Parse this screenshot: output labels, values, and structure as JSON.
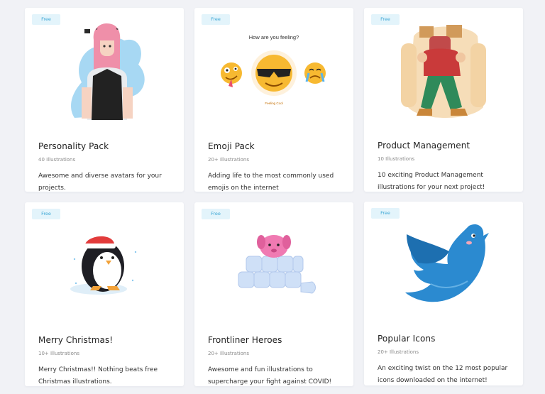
{
  "cards": [
    {
      "badge": "Free",
      "title": "Personality Pack",
      "count": "40 Illustrations",
      "description": "Awesome and diverse avatars for your projects."
    },
    {
      "badge": "Free",
      "title": "Emoji Pack",
      "count": "20+ Illustrations",
      "description": "Adding life to the most commonly used emojis on the internet",
      "art_heading": "How are you feeling?",
      "art_caption": "Feeling Cool"
    },
    {
      "badge": "Free",
      "title": "Product Management",
      "count": "10 Illustrations",
      "description": "10 exciting Product Management illustrations for your next project!"
    },
    {
      "badge": "Free",
      "title": "Merry Christmas!",
      "count": "10+ Illustrations",
      "description": "Merry Christmas!! Nothing beats free Christmas illustrations."
    },
    {
      "badge": "Free",
      "title": "Frontliner Heroes",
      "count": "20+ Illustrations",
      "description": "Awesome and fun illustrations to supercharge your fight against COVID!"
    },
    {
      "badge": "Free",
      "title": "Popular Icons",
      "count": "20+ Illustrations",
      "description": "An exciting twist on the 12 most popular icons downloaded on the internet!"
    }
  ],
  "colors": {
    "page_background": "#f1f2f6",
    "card_background": "#ffffff",
    "badge_background": "#e3f4fb",
    "badge_text": "#3aa6d4"
  }
}
